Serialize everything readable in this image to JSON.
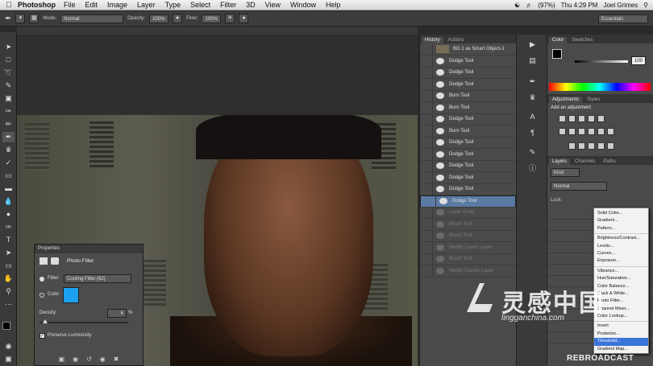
{
  "menubar": {
    "app": "Photoshop",
    "items": [
      "File",
      "Edit",
      "Image",
      "Layer",
      "Type",
      "Select",
      "Filter",
      "3D",
      "View",
      "Window",
      "Help"
    ],
    "battery": "(97%)",
    "clock": "Thu 4:29 PM",
    "user": "Joel Grimes"
  },
  "options": {
    "mode_label": "Mode:",
    "mode_value": "Normal",
    "opacity_label": "Opacity:",
    "opacity_value": "100%",
    "flow_label": "Flow:",
    "flow_value": "100%",
    "workspace": "Essentials"
  },
  "history": {
    "tabs": [
      "History",
      "Actions"
    ],
    "snapshot": "BG 1 as Smart Object-1",
    "items": [
      {
        "label": "Dodge Tool",
        "state": "normal"
      },
      {
        "label": "Dodge Tool",
        "state": "normal"
      },
      {
        "label": "Dodge Tool",
        "state": "normal"
      },
      {
        "label": "Burn Tool",
        "state": "normal"
      },
      {
        "label": "Burn Tool",
        "state": "normal"
      },
      {
        "label": "Dodge Tool",
        "state": "normal"
      },
      {
        "label": "Burn Tool",
        "state": "normal"
      },
      {
        "label": "Dodge Tool",
        "state": "normal"
      },
      {
        "label": "Dodge Tool",
        "state": "normal"
      },
      {
        "label": "Dodge Tool",
        "state": "normal"
      },
      {
        "label": "Dodge Tool",
        "state": "normal"
      },
      {
        "label": "Dodge Tool",
        "state": "normal"
      },
      {
        "label": "Dodge Tool",
        "state": "selected"
      },
      {
        "label": "Layer Order",
        "state": "dim"
      },
      {
        "label": "Brush Tool",
        "state": "dim"
      },
      {
        "label": "Brush Tool",
        "state": "dim"
      },
      {
        "label": "Modify Levels Layer",
        "state": "dim"
      },
      {
        "label": "Brush Tool",
        "state": "dim"
      },
      {
        "label": "Modify Curves Layer",
        "state": "dim"
      }
    ]
  },
  "color_panel": {
    "tabs": [
      "Color",
      "Swatches"
    ],
    "value": "100"
  },
  "adjustments_panel": {
    "tabs": [
      "Adjustments",
      "Styles"
    ],
    "heading": "Add an adjustment"
  },
  "layers_panel": {
    "tabs": [
      "Layers",
      "Channels",
      "Paths"
    ],
    "filter": "Kind",
    "blend": "Normal",
    "lock_label": "Lock:"
  },
  "adjustment_menu": {
    "groups": [
      [
        "Solid Color...",
        "Gradient...",
        "Pattern..."
      ],
      [
        "Brightness/Contrast...",
        "Levels...",
        "Curves...",
        "Exposure..."
      ],
      [
        "Vibrance...",
        "Hue/Saturation...",
        "Color Balance...",
        "Black & White...",
        "Photo Filter...",
        "Channel Mixer...",
        "Color Lookup..."
      ],
      [
        "Invert",
        "Posterize...",
        "Threshold...",
        "Gradient Map..."
      ]
    ],
    "highlighted": "Threshold..."
  },
  "properties": {
    "title": "Properties",
    "panel_name": "Photo Filter",
    "filter_label": "Filter:",
    "filter_value": "Cooling Filter (82)",
    "color_label": "Color",
    "filter_color": "#1aa0ee",
    "density_label": "Density:",
    "density_value": "6",
    "density_unit": "%",
    "density_fraction": 0.06,
    "preserve_label": "Preserve Luminosity",
    "preserve_checked": true
  },
  "watermark": {
    "cn": "灵感中国",
    "url": "lingganchina.com",
    "brand": "REBROADCAST"
  },
  "colors": {
    "panel": "#4a4a4a",
    "selected_row": "#5a7aa3",
    "menu_highlight": "#3b74d8"
  }
}
